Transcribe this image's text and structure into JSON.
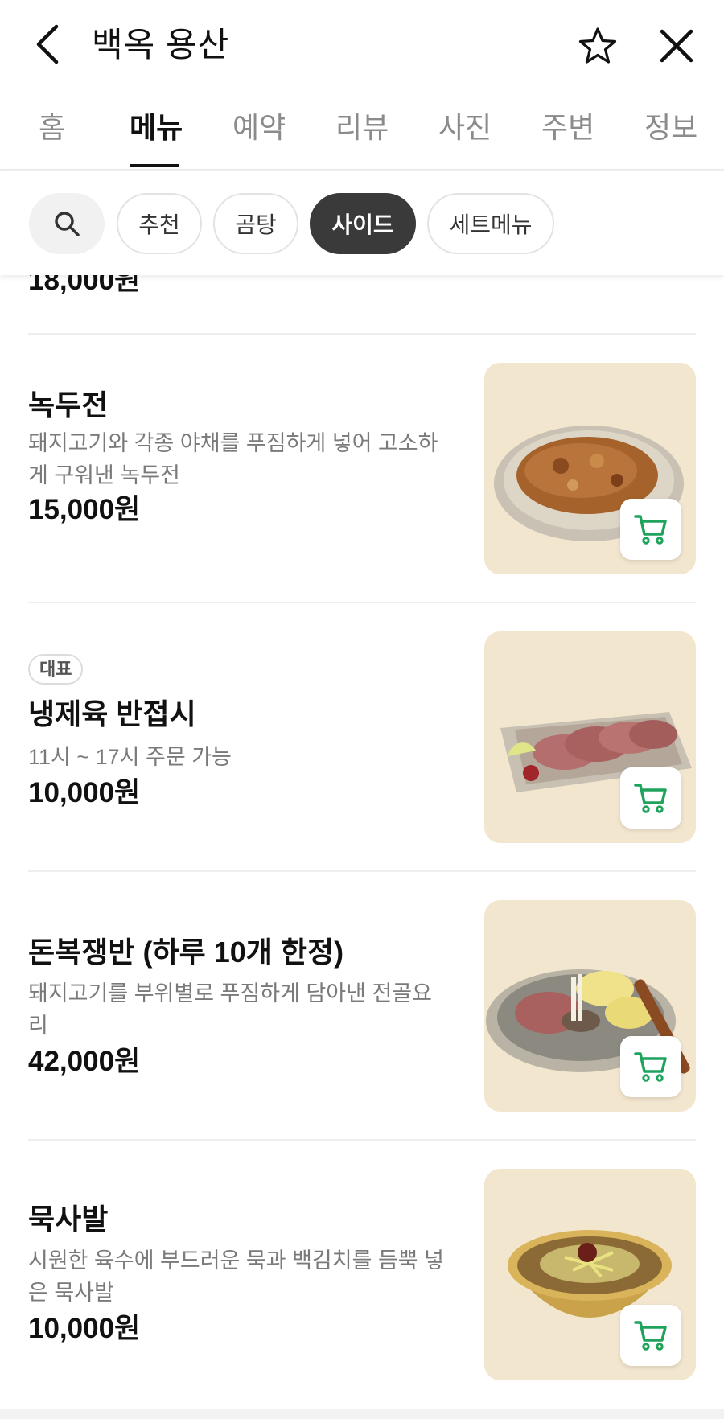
{
  "header": {
    "title": "백옥 용산",
    "icons": [
      "back-arrow-icon",
      "star-icon",
      "close-icon"
    ]
  },
  "tabs": [
    {
      "label": "홈",
      "active": false
    },
    {
      "label": "메뉴",
      "active": true
    },
    {
      "label": "예약",
      "active": false
    },
    {
      "label": "리뷰",
      "active": false
    },
    {
      "label": "사진",
      "active": false
    },
    {
      "label": "주변",
      "active": false
    },
    {
      "label": "정보",
      "active": false
    }
  ],
  "filters": {
    "search_icon": "search-icon",
    "chips": [
      {
        "label": "추천",
        "selected": false
      },
      {
        "label": "곰탕",
        "selected": false
      },
      {
        "label": "사이드",
        "selected": true
      },
      {
        "label": "세트메뉴",
        "selected": false
      }
    ]
  },
  "partial_item": {
    "price": "18,000원"
  },
  "menu_items": [
    {
      "name": "녹두전",
      "description": "돼지고기와 각종 야채를 푸짐하게 넣어 고소하게 구워낸 녹두전",
      "price": "15,000원",
      "badge": ""
    },
    {
      "name": "냉제육 반접시",
      "description": "11시 ~ 17시 주문 가능",
      "price": "10,000원",
      "badge": "대표"
    },
    {
      "name": "돈복쟁반 (하루 10개 한정)",
      "description": "돼지고기를 부위별로 푸짐하게 담아낸 전골요리",
      "price": "42,000원",
      "badge": ""
    },
    {
      "name": "묵사발",
      "description": "시원한 육수에 부드러운 묵과 백김치를 듬뿍 넣은 묵사발",
      "price": "10,000원",
      "badge": ""
    }
  ],
  "colors": {
    "cart_icon": "#1fa35c",
    "selected_chip": "#3a3a3a",
    "thumb_bg": "#f3e6cf"
  }
}
